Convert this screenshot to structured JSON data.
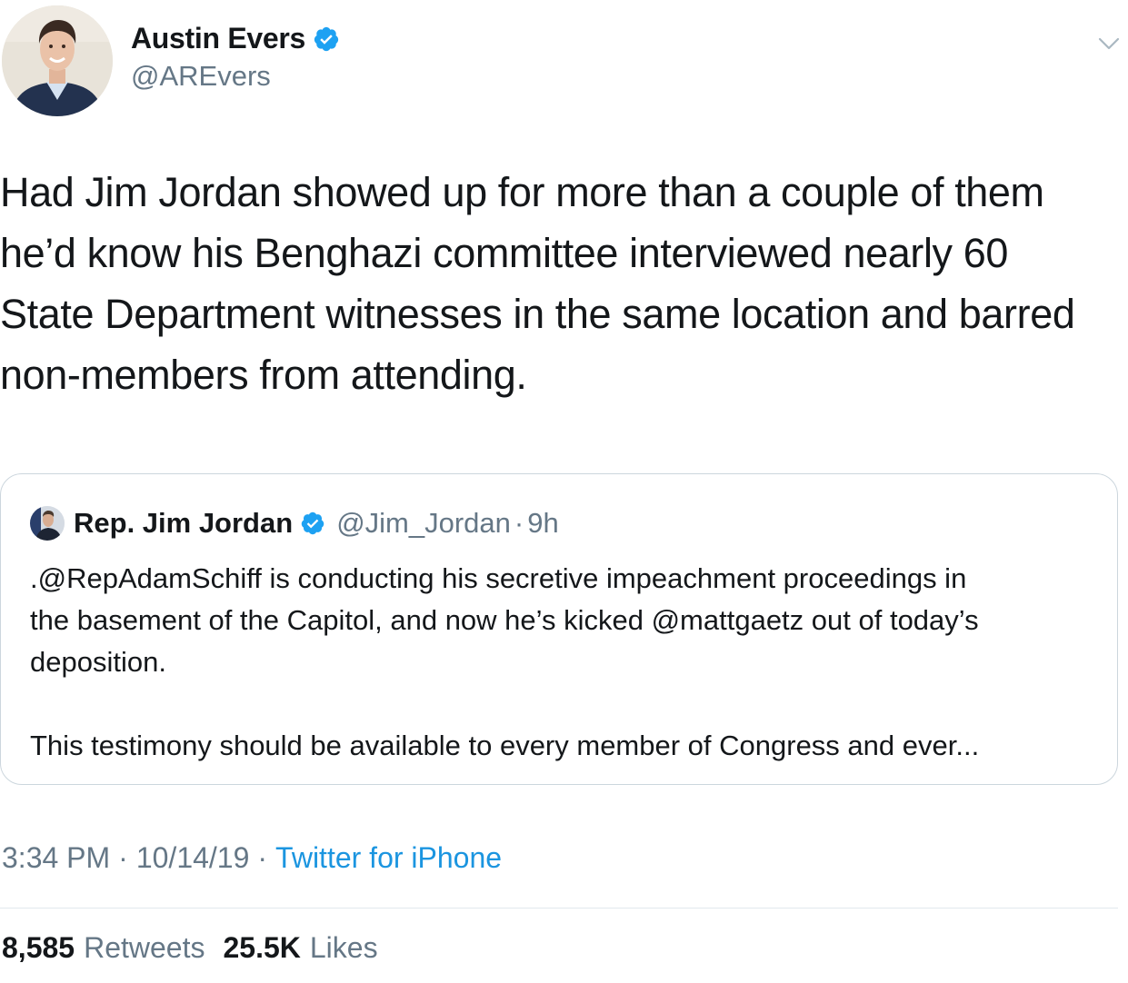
{
  "tweet": {
    "author": {
      "name": "Austin Evers",
      "handle": "@AREvers",
      "verified": true
    },
    "text": "Had Jim Jordan showed up for more than a couple of them\nhe’d know his Benghazi committee interviewed nearly 60\nState Department witnesses in the same location and barred\nnon-members from attending.",
    "quoted": {
      "author": {
        "name": "Rep. Jim Jordan",
        "handle": "@Jim_Jordan",
        "verified": true
      },
      "separator": "·",
      "time": "9h",
      "text": ".@RepAdamSchiff is conducting his secretive impeachment proceedings in\nthe basement of the Capitol, and now he’s kicked @mattgaetz out of today’s\ndeposition.\n\nThis testimony should be available to every member of Congress and ever..."
    },
    "meta": {
      "time": "3:34 PM",
      "date": "10/14/19",
      "separator": "·",
      "source": "Twitter for iPhone"
    },
    "stats": {
      "retweets_count": "8,585",
      "retweets_label": "Retweets",
      "likes_count": "25.5K",
      "likes_label": "Likes"
    }
  },
  "colors": {
    "text": "#14171a",
    "secondary": "#657786",
    "accent": "#1da1f2",
    "link": "#1b95e0",
    "border": "#ccd6dd"
  },
  "icons": {
    "verified": "verified-badge-icon",
    "more": "chevron-down-icon"
  }
}
